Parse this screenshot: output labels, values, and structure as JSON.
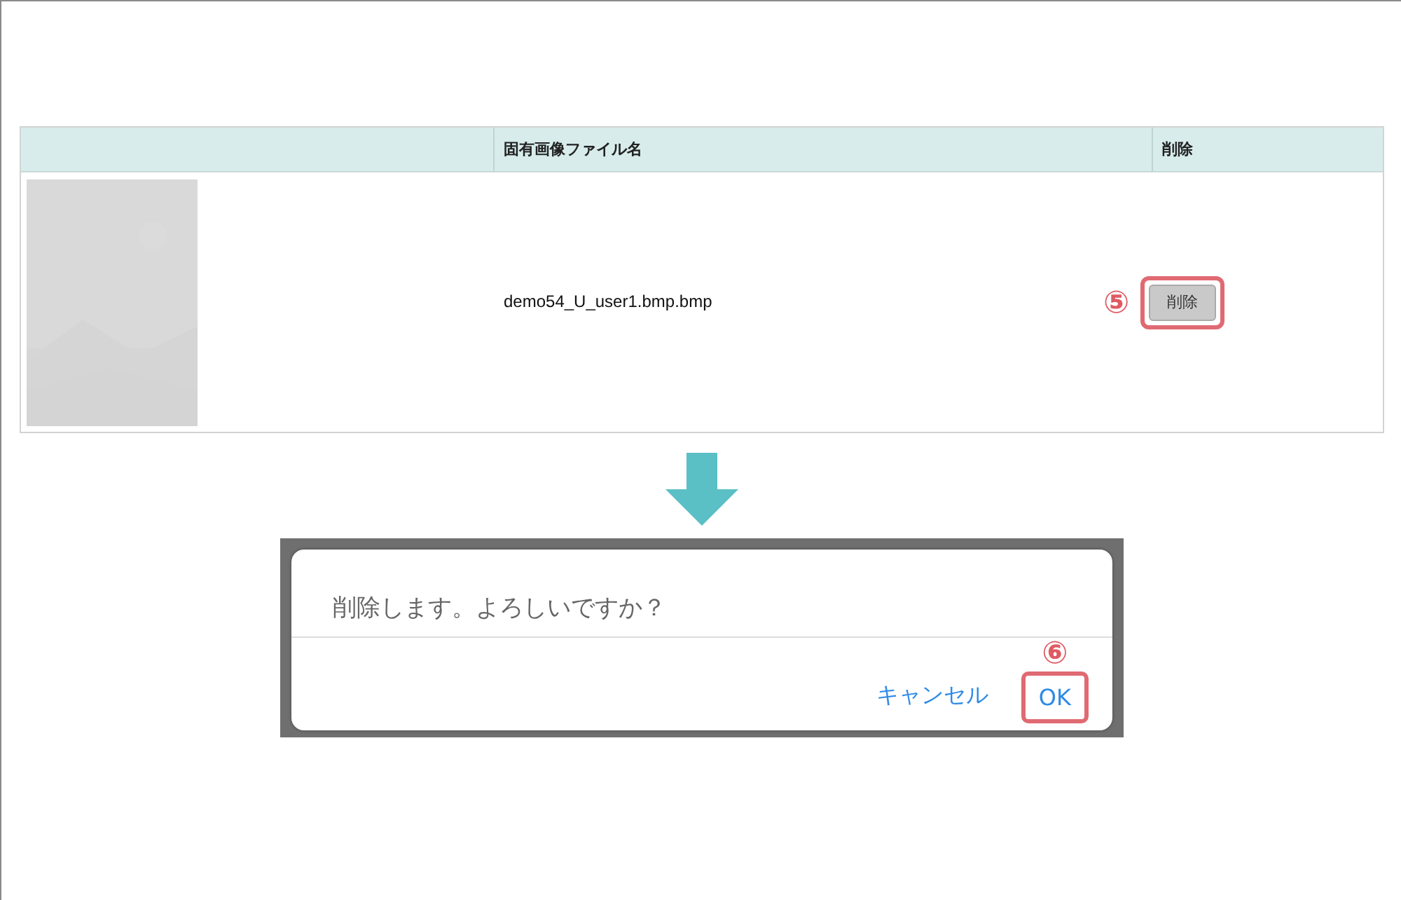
{
  "table": {
    "columns": [
      "固有画像ファイル名",
      "削除"
    ],
    "rows": [
      {
        "file_name": "demo54_U_user1.bmp.bmp",
        "delete_button": "削除",
        "step": "⑤"
      }
    ]
  },
  "dialog": {
    "message": "削除します。よろしいですか？",
    "buttons": [
      {
        "label": "キャンセル",
        "highlighted": false
      },
      {
        "label": "OK",
        "highlighted": true,
        "step": "⑥"
      }
    ]
  }
}
